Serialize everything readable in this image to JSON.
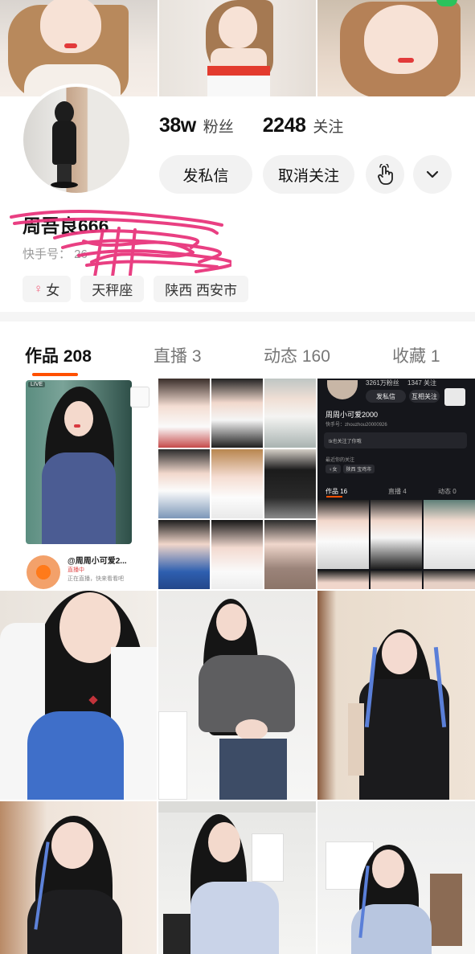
{
  "profile": {
    "followers_value": "38w",
    "followers_label": "粉丝",
    "following_value": "2248",
    "following_label": "关注",
    "name": "周吾良666",
    "id_text": "快手号：                 26",
    "tags": [
      {
        "icon": "♀",
        "label": "女"
      },
      {
        "icon": "",
        "label": "天秤座"
      },
      {
        "icon": "",
        "label": "陕西 西安市"
      }
    ]
  },
  "actions": {
    "message_label": "发私信",
    "unfollow_label": "取消关注",
    "hand_icon": "tap-hand-icon",
    "more_icon": "chevron-down-icon"
  },
  "tabs": [
    {
      "label": "作品 208",
      "active": true
    },
    {
      "label": "直播 3",
      "active": false
    },
    {
      "label": "动态 160",
      "active": false
    },
    {
      "label": "收藏 1",
      "active": false
    }
  ],
  "live_card": {
    "badge": "LIVE",
    "title": "@周周小可爱2...",
    "status": "直播中",
    "hint": "正在直播，快来看看吧"
  },
  "embedded_screenshot": {
    "followers": "3261万粉丝",
    "following": "1347 关注",
    "message_label": "发私信",
    "follow_back_label": "互相关注",
    "name": "周周小可爱2000",
    "id_text": "快手号：zhouzhou20000926",
    "mutual_text": "tk也关注了你哦",
    "recent_label": "最近你的关注",
    "tags": [
      "♀女",
      "陕西 宝鸡市"
    ],
    "tabs": [
      {
        "label": "作品 16",
        "active": true
      },
      {
        "label": "直播 4",
        "active": false
      },
      {
        "label": "动态 0",
        "active": false
      }
    ]
  },
  "colors": {
    "accent": "#ff5000",
    "button_bg": "#f2f2f2",
    "tag_bg": "#f4f4f4",
    "scribble": "#e8357c",
    "female_icon": "#f25b79"
  }
}
